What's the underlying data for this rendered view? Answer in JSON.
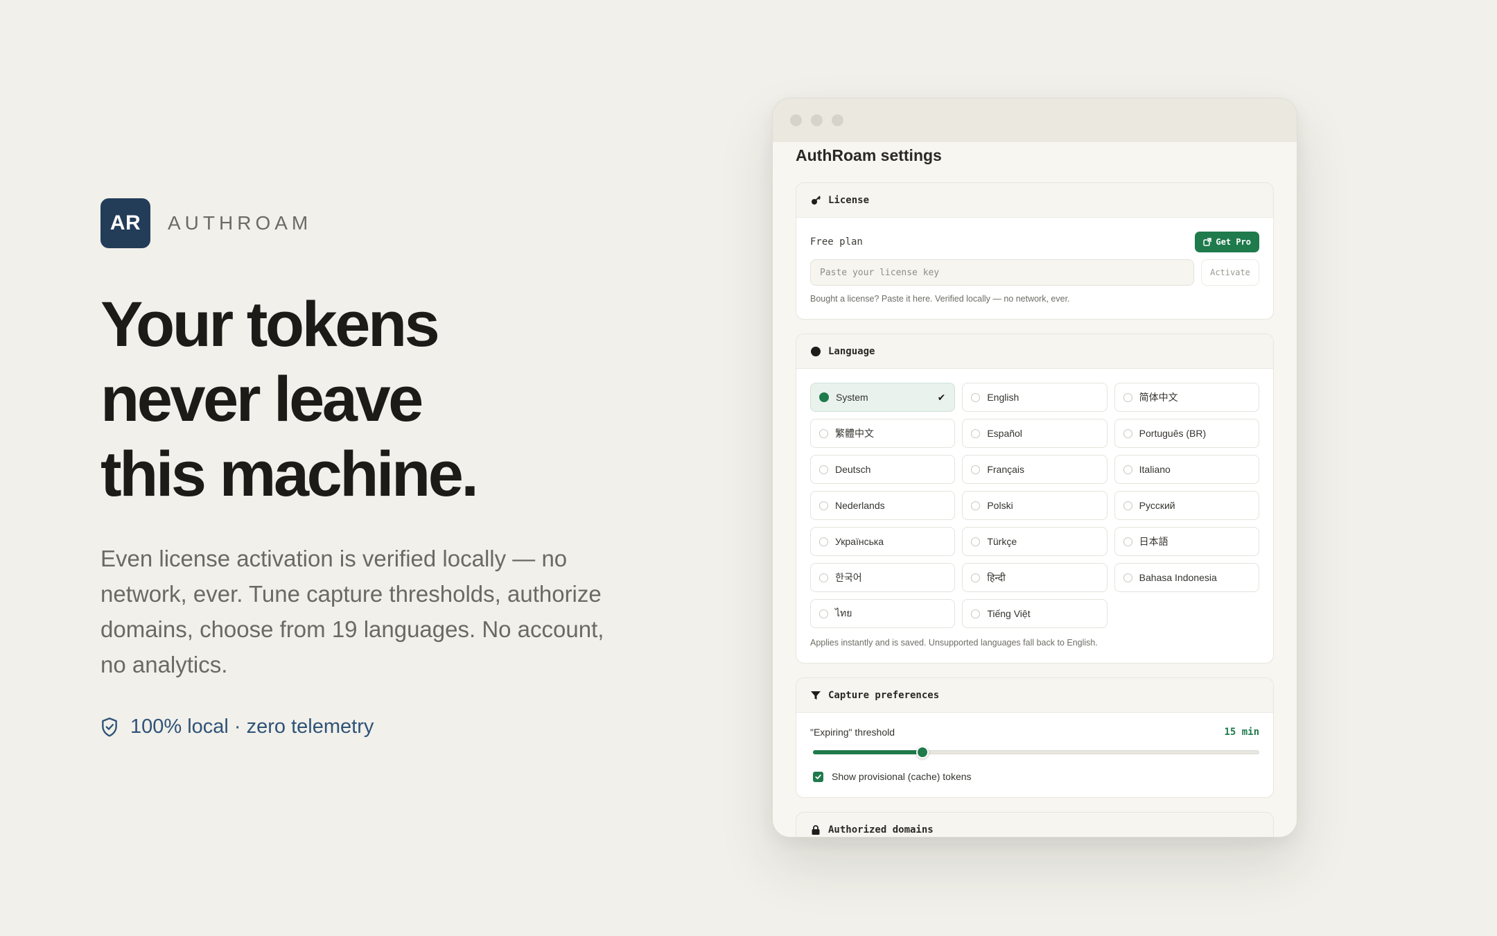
{
  "brand": {
    "logo_text": "AR",
    "name": "AUTHROAM"
  },
  "hero": {
    "headline": [
      "Your tokens",
      "never leave",
      "this machine."
    ],
    "subtext": "Even license activation is verified locally — no network, ever. Tune capture thresholds, authorize domains, choose from 19 languages. No account, no analytics.",
    "badge": "100% local · zero telemetry"
  },
  "window": {
    "title": "AuthRoam settings",
    "license": {
      "heading": "License",
      "plan": "Free plan",
      "get_pro": "Get Pro",
      "key_placeholder": "Paste your license key",
      "activate": "Activate",
      "hint": "Bought a license? Paste it here. Verified locally — no network, ever."
    },
    "language": {
      "heading": "Language",
      "options": [
        "System",
        "English",
        "简体中文",
        "繁體中文",
        "Español",
        "Português (BR)",
        "Deutsch",
        "Français",
        "Italiano",
        "Nederlands",
        "Polski",
        "Русский",
        "Українська",
        "Türkçe",
        "日本語",
        "한국어",
        "हिन्दी",
        "Bahasa Indonesia",
        "ไทย",
        "Tiếng Việt"
      ],
      "selected": "System",
      "hint": "Applies instantly and is saved. Unsupported languages fall back to English."
    },
    "capture": {
      "heading": "Capture preferences",
      "threshold_label": "\"Expiring\" threshold",
      "threshold_value": "15 min",
      "threshold_fraction": 0.245,
      "show_provisional": "Show provisional (cache) tokens",
      "show_provisional_checked": true
    },
    "domains": {
      "heading": "Authorized domains"
    }
  },
  "colors": {
    "accent": "#1f7a4c",
    "brand_bg": "#233d59",
    "badge_text": "#2f5378",
    "page_bg": "#f1f0ea"
  }
}
